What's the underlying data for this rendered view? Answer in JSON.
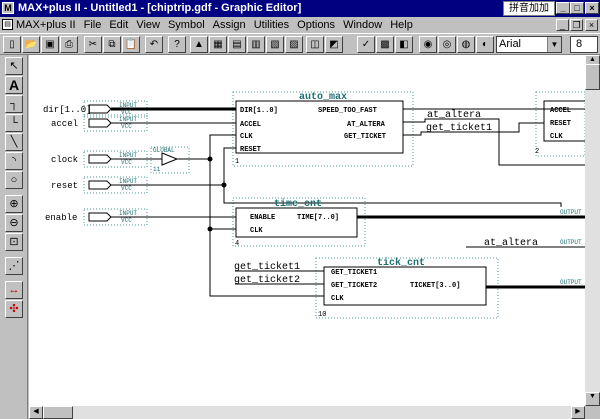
{
  "window": {
    "title": "MAX+plus II - Untitled1 - [chiptrip.gdf - Graphic Editor]",
    "ime_label": "拼音加加"
  },
  "menu": [
    "MAX+plus II",
    "File",
    "Edit",
    "View",
    "Symbol",
    "Assign",
    "Utilities",
    "Options",
    "Window",
    "Help"
  ],
  "toolbar": {
    "icons": [
      "new-icon",
      "open-icon",
      "save-icon",
      "print-icon",
      "cut-icon",
      "copy-icon",
      "paste-icon",
      "undo-icon",
      "help-icon",
      "hierarchy-up-icon",
      "floorplan-icon",
      "compiler-icon",
      "simulator-icon",
      "timing-icon",
      "programmer-icon",
      "project-icon",
      "set-project-icon",
      "save-check-icon",
      "save-compile-icon",
      "save-simulate-icon",
      "compile-icon",
      "simulate-icon",
      "timing-analyze-icon",
      "program-icon"
    ],
    "font": "Arial",
    "font_size": "8"
  },
  "palette": [
    "select-arrow-icon",
    "text-tool-icon",
    "orthogonal-line-icon",
    "orthogonal-line-2-icon",
    "diagonal-line-icon",
    "arc-icon",
    "circle-icon",
    "zoom-in-icon",
    "zoom-out-icon",
    "fit-window-icon",
    "rubberband-icon",
    "connect-dots-icon",
    "disconnect-icon"
  ],
  "schematic": {
    "input_pins": [
      {
        "name": "dir[1..0]",
        "type": "INPUT",
        "vcc": "VCC"
      },
      {
        "name": "accel",
        "type": "INPUT",
        "vcc": "VCC"
      },
      {
        "name": "clock",
        "type": "INPUT",
        "vcc": "VCC"
      },
      {
        "name": "reset",
        "type": "INPUT",
        "vcc": "VCC"
      },
      {
        "name": "enable",
        "type": "INPUT",
        "vcc": "VCC"
      }
    ],
    "global": {
      "label": "GLOBAL",
      "num": "11"
    },
    "auto_max": {
      "name": "auto_max",
      "ports_in": [
        "DIR[1..0]",
        "ACCEL",
        "CLK",
        "RESET"
      ],
      "ports_out": [
        "SPEED_TOO_FAST",
        "AT_ALTERA",
        "GET_TICKET"
      ],
      "num": "1"
    },
    "time_cnt": {
      "name": "time_cnt",
      "ports_in": [
        "ENABLE",
        "CLK"
      ],
      "port_out": "TIME[7..0]",
      "num": "4"
    },
    "tick_cnt": {
      "name": "tick_cnt",
      "ports_in": [
        "GET_TICKET1",
        "GET_TICKET2",
        "CLK"
      ],
      "port_out": "TICKET[3..0]",
      "num": "10"
    },
    "right_block": {
      "ports": [
        "ACCEL",
        "RESET",
        "CLK"
      ],
      "num": "2"
    },
    "net_labels": [
      "at_altera",
      "get_ticket1",
      "at_altera",
      "get_ticket1",
      "get_ticket2"
    ],
    "output_label": "OUTPUT"
  },
  "colors": {
    "titlebar": "#000080",
    "wire": "#000000",
    "dotted_box": "#4a9a9a",
    "canvas": "#ffffff"
  }
}
